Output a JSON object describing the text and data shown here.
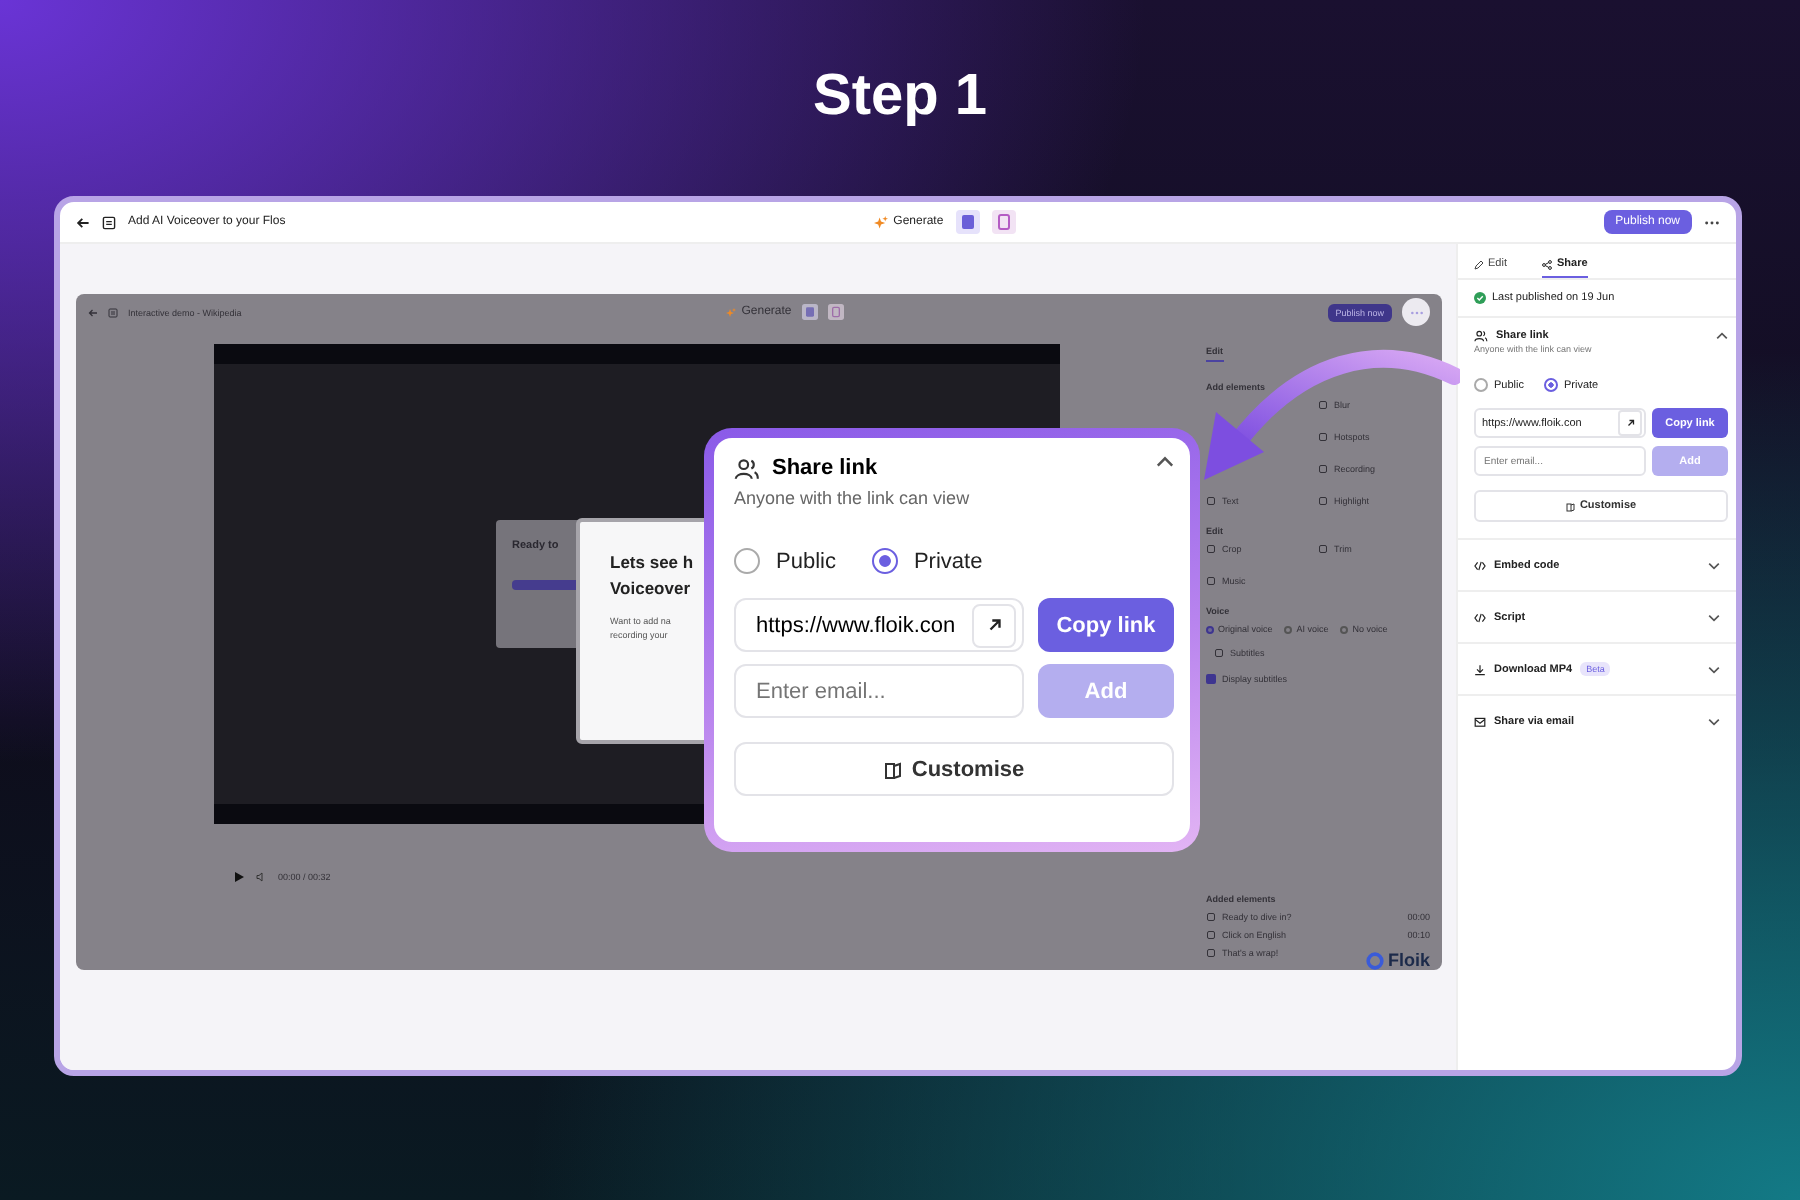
{
  "heading": "Step 1",
  "app_bar": {
    "title": "Add AI Voiceover to your Flos",
    "generate": "Generate",
    "publish": "Publish now"
  },
  "editor": {
    "title": "Interactive demo - Wikipedia",
    "generate": "Generate",
    "publish": "Publish now",
    "video": {
      "card_title": "Ready to",
      "popup_title": [
        "Lets see h",
        "Voiceover"
      ],
      "popup_text": [
        "Want to add na",
        "recording your"
      ],
      "time": "00:00 / 00:32"
    },
    "panel": {
      "tabs": [
        {
          "label": "Edit",
          "selected": true
        }
      ],
      "add_elements_title": "Add elements",
      "elements": [
        {
          "label": "Blur"
        },
        {
          "label": "Hotspots"
        },
        {
          "label": "Recording"
        },
        {
          "label": "Text"
        },
        {
          "label": "Highlight"
        }
      ],
      "edit_title": "Edit",
      "edit_tools": [
        "Crop",
        "Trim",
        "Music"
      ],
      "voice_title": "Voice",
      "voice_options": [
        {
          "label": "Original voice",
          "selected": true
        },
        {
          "label": "AI voice",
          "selected": false
        },
        {
          "label": "No voice",
          "selected": false
        }
      ],
      "subtitles": "Subtitles",
      "display_subtitles": {
        "label": "Display subtitles",
        "checked": true
      },
      "added_title": "Added elements",
      "added": [
        {
          "label": "Ready to dive in?",
          "time": "00:00"
        },
        {
          "label": "Click on English",
          "time": "00:10"
        },
        {
          "label": "That's a wrap!"
        }
      ],
      "logo": "Floik"
    }
  },
  "callout": {
    "title": "Share link",
    "expanded": true,
    "subtitle": "Anyone with the link can view",
    "visibility": [
      {
        "label": "Public",
        "selected": false
      },
      {
        "label": "Private",
        "selected": true
      }
    ],
    "url": "https://www.floik.con",
    "copy": "Copy link",
    "email_placeholder": "Enter email...",
    "add": "Add",
    "add_disabled": true,
    "customise": "Customise"
  },
  "right_panel": {
    "tabs": [
      {
        "label": "Edit",
        "selected": false
      },
      {
        "label": "Share",
        "selected": true
      }
    ],
    "status": "Last published on 19 Jun",
    "share_link": {
      "title": "Share link",
      "expanded": true,
      "subtitle": "Anyone with the link can view",
      "visibility": [
        {
          "label": "Public",
          "selected": false
        },
        {
          "label": "Private",
          "selected": true
        }
      ],
      "url": "https://www.floik.con",
      "copy": "Copy link",
      "email_placeholder": "Enter email...",
      "add": "Add",
      "add_disabled": true,
      "customise": "Customise"
    },
    "sections": [
      {
        "label": "Embed code",
        "kind": "code",
        "expanded": false
      },
      {
        "label": "Script",
        "kind": "code",
        "expanded": false
      },
      {
        "label": "Download MP4",
        "kind": "download",
        "badge": "Beta",
        "expanded": false
      },
      {
        "label": "Share via email",
        "kind": "mail",
        "expanded": false
      }
    ]
  }
}
